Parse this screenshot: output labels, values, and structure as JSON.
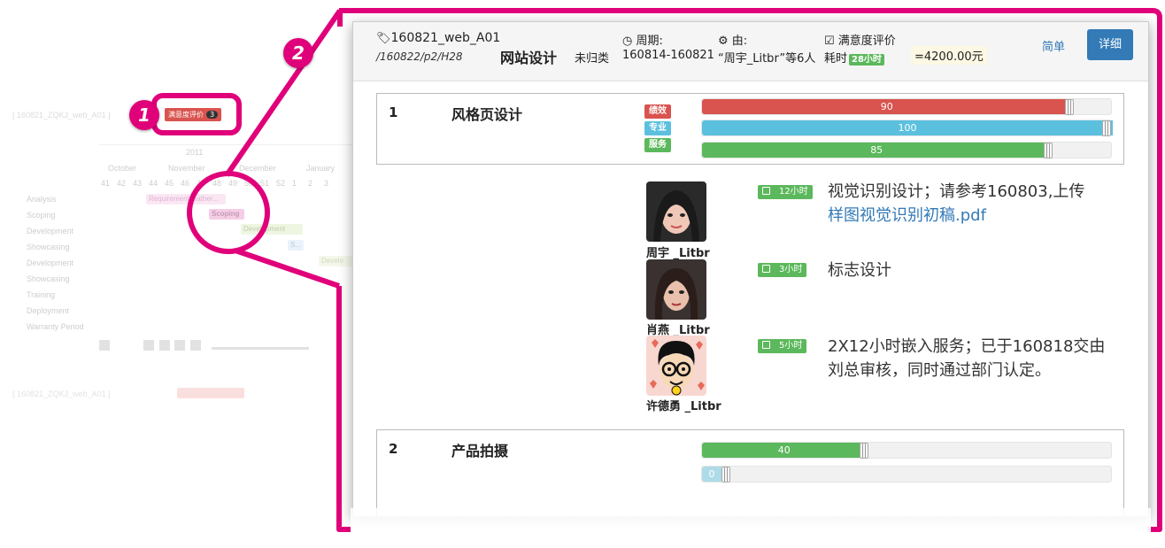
{
  "background": {
    "project_line": "[ 160821_ZQKJ_web_A01 ]",
    "top_badge": {
      "label": "满意度评价",
      "count": "3"
    },
    "year": "2011",
    "months": [
      "October",
      "November",
      "December",
      "January"
    ],
    "weeks": [
      "41",
      "42",
      "43",
      "44",
      "45",
      "46",
      "47",
      "48",
      "49",
      "50",
      "51",
      "52",
      "1",
      "2",
      "3"
    ],
    "rows": [
      "Analysis",
      "Scoping",
      "Development",
      "Showcasing",
      "Development",
      "Showcasing",
      "Training",
      "Deployment",
      "Warranty Period"
    ],
    "bars": {
      "requirement": "Requirement Gather...",
      "scoping": "Scoping",
      "development": "Development",
      "showcase": "S...",
      "develop2": "Develo"
    },
    "footer_line": "[ 160821_ZQKJ_web_A01 ]"
  },
  "callouts": {
    "one": "1",
    "two": "2"
  },
  "header": {
    "code": "160821_web_A01",
    "path": "/160822/p2/H28",
    "title": "网站设计",
    "category": "未归类",
    "cycle_label": "周期:",
    "cycle_value": "160814-160821",
    "by_label": "由:",
    "by_value": "“周宇_Litbr”等6人",
    "sat_label": "满意度评价",
    "spent_label": "耗时",
    "spent_hours": "28小时",
    "amount": "=4200.00元",
    "btn_simple": "简单",
    "btn_detail": "详细"
  },
  "colors": {
    "red": "#d9534f",
    "blue": "#5bc0de",
    "green": "#5cb85c",
    "magenta": "#e0007a",
    "primary": "#337ab7"
  },
  "items": [
    {
      "num": "1",
      "title": "风格页设计",
      "tags": [
        "绩效",
        "专业",
        "服务"
      ],
      "progress": [
        {
          "value": 90,
          "label": "90",
          "color": "#d9534f"
        },
        {
          "value": 100,
          "label": "100",
          "color": "#5bc0de"
        },
        {
          "value": 85,
          "label": "85",
          "color": "#5cb85c"
        }
      ]
    },
    {
      "num": "2",
      "title": "产品拍摄",
      "progress": [
        {
          "value": 40,
          "label": "40",
          "color": "#5cb85c"
        },
        {
          "value": 0,
          "label": "0",
          "color": "#5bc0de"
        }
      ]
    }
  ],
  "tasks": [
    {
      "name": "周宇 _Litbr",
      "hours": "12小时",
      "text": "视觉识别设计；请参考160803,上传",
      "link": "样图视觉识别初稿.pdf"
    },
    {
      "name": "肖燕 _Litbr",
      "hours": "3小时",
      "text": "标志设计"
    },
    {
      "name": "许德勇 _Litbr",
      "hours": "5小时",
      "text": "2X12小时嵌入服务；已于160818交由刘总审核，同时通过部门认定。"
    }
  ]
}
